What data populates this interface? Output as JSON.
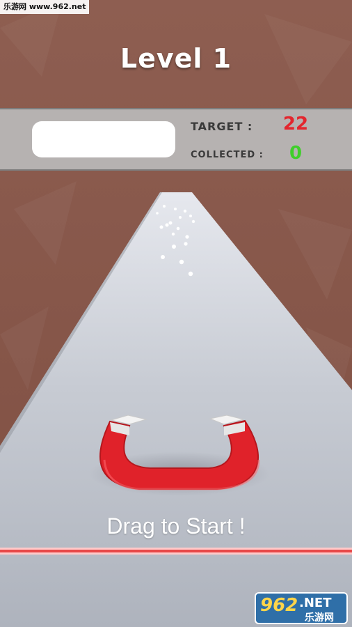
{
  "watermark": {
    "text": "乐游网 www.962.net"
  },
  "hud": {
    "level_title": "Level 1",
    "progress": 0,
    "target_label": "TARGET :",
    "target_value": "22",
    "collected_label": "COLLECTED :",
    "collected_value": "0"
  },
  "prompt": {
    "text": "Drag to Start !"
  },
  "logo": {
    "brand": "962",
    "suffix": ".NET",
    "name": "乐游网"
  },
  "colors": {
    "wall": "#8a5a4c",
    "road": "#b9bec8",
    "magnet_red": "#e3232b",
    "target_value": "#e3262e",
    "collected_value": "#3fcf2a",
    "finish_line": "#e84848"
  },
  "icons": [
    "horseshoe-magnet-icon",
    "finish-line-stripe"
  ]
}
